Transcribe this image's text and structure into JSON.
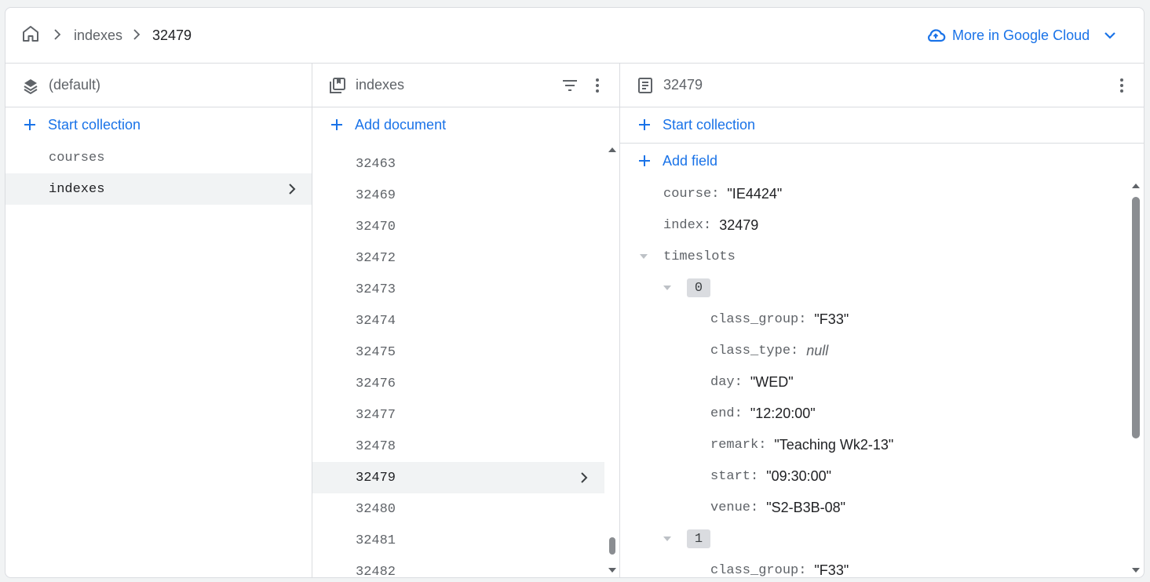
{
  "breadcrumb": {
    "items": [
      "indexes",
      "32479"
    ]
  },
  "cloud_link": {
    "label": "More in Google Cloud"
  },
  "colors": {
    "accent": "#1a73e8",
    "muted": "#5f6368",
    "border": "#dadce0",
    "selected_bg": "#f1f3f4"
  },
  "database_panel": {
    "title": "(default)",
    "start_collection": "Start collection",
    "collections": [
      "courses",
      "indexes"
    ],
    "selected": "indexes"
  },
  "collection_panel": {
    "title": "indexes",
    "add_document": "Add document",
    "documents": [
      "32463",
      "32469",
      "32470",
      "32472",
      "32473",
      "32474",
      "32475",
      "32476",
      "32477",
      "32478",
      "32479",
      "32480",
      "32481",
      "32482"
    ],
    "selected": "32479"
  },
  "document_panel": {
    "title": "32479",
    "start_collection": "Start collection",
    "add_field": "Add field",
    "fields": {
      "course_key": "course:",
      "course_val": "\"IE4424\"",
      "index_key": "index:",
      "index_val": "32479",
      "timeslots_key": "timeslots",
      "slot0_label": "0",
      "slot0": {
        "class_group_key": "class_group:",
        "class_group_val": "\"F33\"",
        "class_type_key": "class_type:",
        "class_type_val": "null",
        "day_key": "day:",
        "day_val": "\"WED\"",
        "end_key": "end:",
        "end_val": "\"12:20:00\"",
        "remark_key": "remark:",
        "remark_val": "\"Teaching Wk2-13\"",
        "start_key": "start:",
        "start_val": "\"09:30:00\"",
        "venue_key": "venue:",
        "venue_val": "\"S2-B3B-08\""
      },
      "slot1_label": "1",
      "slot1": {
        "class_group_key": "class_group:",
        "class_group_val": "\"F33\""
      }
    }
  }
}
